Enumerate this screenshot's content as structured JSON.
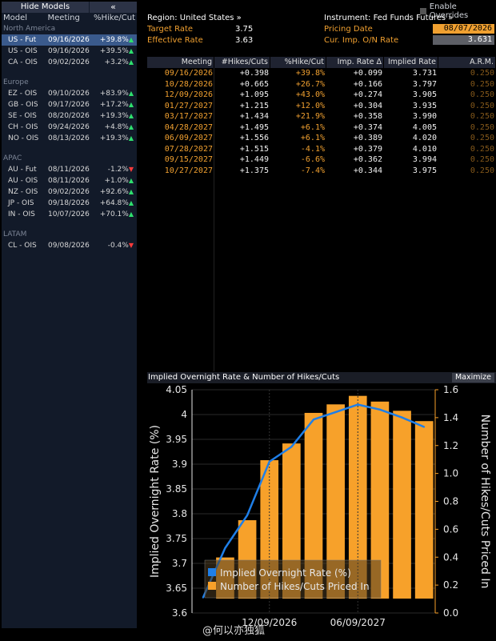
{
  "sidebar": {
    "hide_models_label": "Hide Models",
    "collapse_glyph": "«",
    "col_model": "Model",
    "col_meeting": "Meeting",
    "col_hike_cut": "%Hike/Cut",
    "groups": [
      {
        "label": "North America",
        "rows": [
          {
            "model": "US - Fut",
            "meeting": "09/16/2026",
            "pct": "+39.8%",
            "dir": "up",
            "selected": true
          },
          {
            "model": "US - OIS",
            "meeting": "09/16/2026",
            "pct": "+39.5%",
            "dir": "up"
          },
          {
            "model": "CA - OIS",
            "meeting": "09/02/2026",
            "pct": "+3.2%",
            "dir": "up"
          }
        ]
      },
      {
        "label": "Europe",
        "rows": [
          {
            "model": "EZ - OIS",
            "meeting": "09/10/2026",
            "pct": "+83.9%",
            "dir": "up"
          },
          {
            "model": "GB - OIS",
            "meeting": "09/17/2026",
            "pct": "+17.2%",
            "dir": "up"
          },
          {
            "model": "SE - OIS",
            "meeting": "08/20/2026",
            "pct": "+19.3%",
            "dir": "up"
          },
          {
            "model": "CH - OIS",
            "meeting": "09/24/2026",
            "pct": "+4.8%",
            "dir": "up"
          },
          {
            "model": "NO - OIS",
            "meeting": "08/13/2026",
            "pct": "+19.3%",
            "dir": "up"
          }
        ]
      },
      {
        "label": "APAC",
        "rows": [
          {
            "model": "AU - Fut",
            "meeting": "08/11/2026",
            "pct": "-1.2%",
            "dir": "down"
          },
          {
            "model": "AU - OIS",
            "meeting": "08/11/2026",
            "pct": "+1.0%",
            "dir": "up"
          },
          {
            "model": "NZ - OIS",
            "meeting": "09/02/2026",
            "pct": "+92.6%",
            "dir": "up"
          },
          {
            "model": "JP - OIS",
            "meeting": "09/18/2026",
            "pct": "+64.8%",
            "dir": "up"
          },
          {
            "model": "IN - OIS",
            "meeting": "10/07/2026",
            "pct": "+70.1%",
            "dir": "up"
          }
        ]
      },
      {
        "label": "LATAM",
        "rows": [
          {
            "model": "CL - OIS",
            "meeting": "09/08/2026",
            "pct": "-0.4%",
            "dir": "down"
          }
        ]
      }
    ]
  },
  "info": {
    "region": "Region: United States »",
    "instrument": "Instrument: Fed Funds Futures »",
    "enable_overrides": "Enable Overrides",
    "target_rate_label": "Target Rate",
    "target_rate": "3.75",
    "effective_rate_label": "Effective Rate",
    "effective_rate": "3.63",
    "pricing_date_label": "Pricing Date",
    "pricing_date": "08/07/2026",
    "cur_imp_label": "Cur. Imp. O/N Rate",
    "cur_imp": "3.631"
  },
  "table": {
    "headers": [
      "Meeting",
      "#Hikes/Cuts",
      "%Hike/Cut",
      "Imp. Rate Δ",
      "Implied Rate",
      "A.R.M."
    ],
    "rows": [
      [
        "09/16/2026",
        "+0.398",
        "+39.8%",
        "+0.099",
        "3.731",
        "0.250"
      ],
      [
        "10/28/2026",
        "+0.665",
        "+26.7%",
        "+0.166",
        "3.797",
        "0.250"
      ],
      [
        "12/09/2026",
        "+1.095",
        "+43.0%",
        "+0.274",
        "3.905",
        "0.250"
      ],
      [
        "01/27/2027",
        "+1.215",
        "+12.0%",
        "+0.304",
        "3.935",
        "0.250"
      ],
      [
        "03/17/2027",
        "+1.434",
        "+21.9%",
        "+0.358",
        "3.990",
        "0.250"
      ],
      [
        "04/28/2027",
        "+1.495",
        "+6.1%",
        "+0.374",
        "4.005",
        "0.250"
      ],
      [
        "06/09/2027",
        "+1.556",
        "+6.1%",
        "+0.389",
        "4.020",
        "0.250"
      ],
      [
        "07/28/2027",
        "+1.515",
        "-4.1%",
        "+0.379",
        "4.010",
        "0.250"
      ],
      [
        "09/15/2027",
        "+1.449",
        "-6.6%",
        "+0.362",
        "3.994",
        "0.250"
      ],
      [
        "10/27/2027",
        "+1.375",
        "-7.4%",
        "+0.344",
        "3.975",
        "0.250"
      ]
    ]
  },
  "chart_header": {
    "title": "Implied Overnight Rate & Number of Hikes/Cuts",
    "maximize_label": "Maximize"
  },
  "chart_data": {
    "type": "bar",
    "categories": [
      "08/07/2026",
      "09/16/2026",
      "10/28/2026",
      "12/09/2026",
      "01/27/2027",
      "03/17/2027",
      "04/28/2027",
      "06/09/2027",
      "07/28/2027",
      "09/15/2027",
      "10/27/2027"
    ],
    "x_tick_labels": [
      "12/09/2026",
      "06/09/2027"
    ],
    "series": [
      {
        "name": "Implied Overnight Rate (%)",
        "type": "line",
        "axis": "left",
        "color": "#1f7fe8",
        "values": [
          3.631,
          3.731,
          3.797,
          3.905,
          3.935,
          3.99,
          4.005,
          4.02,
          4.01,
          3.994,
          3.975
        ]
      },
      {
        "name": "Number of Hikes/Cuts Priced In",
        "type": "bar",
        "axis": "right",
        "color": "#f7a12a",
        "values": [
          null,
          0.398,
          0.665,
          1.095,
          1.215,
          1.434,
          1.495,
          1.556,
          1.515,
          1.449,
          1.375
        ]
      }
    ],
    "ylabel_left": "Implied Overnight Rate (%)",
    "ylabel_right": "Number of Hikes/Cuts Priced In",
    "ylim_left": [
      3.6,
      4.05
    ],
    "yticks_left": [
      3.6,
      3.65,
      3.7,
      3.75,
      3.8,
      3.85,
      3.9,
      3.95,
      4.0,
      4.05
    ],
    "ylim_right": [
      0,
      1.6
    ],
    "yticks_right": [
      0.0,
      0.2,
      0.4,
      0.6,
      0.8,
      1.0,
      1.2,
      1.4,
      1.6
    ],
    "grid": true,
    "legend_position": "bottom-left"
  },
  "watermark": "@何以亦独狐"
}
